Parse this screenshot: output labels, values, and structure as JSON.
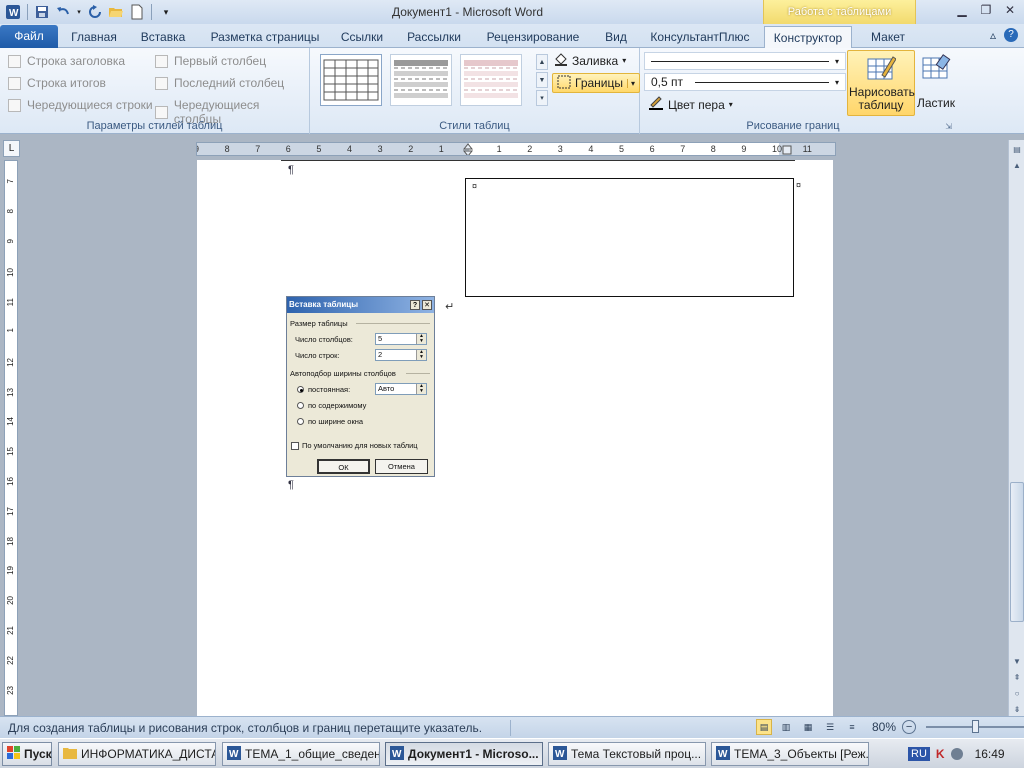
{
  "window": {
    "title": "Документ1  -  Microsoft Word",
    "context_tab_header": "Работа с таблицами"
  },
  "tabs": [
    "Файл",
    "Главная",
    "Вставка",
    "Разметка страницы",
    "Ссылки",
    "Рассылки",
    "Рецензирование",
    "Вид",
    "КонсультантПлюс",
    "Конструктор",
    "Макет"
  ],
  "ribbon": {
    "style_options": {
      "label": "Параметры стилей таблиц",
      "items": [
        "Строка заголовка",
        "Строка итогов",
        "Чередующиеся строки",
        "Первый столбец",
        "Последний столбец",
        "Чередующиеся столбцы"
      ]
    },
    "table_styles": {
      "label": "Стили таблиц",
      "fill_label": "Заливка",
      "borders_label": "Границы"
    },
    "draw_borders": {
      "label": "Рисование границ",
      "line_weight": "0,5 пт",
      "pen_color_label": "Цвет пера",
      "draw_table_label": "Нарисовать таблицу",
      "eraser_label": "Ластик"
    }
  },
  "ruler": {
    "h_ticks": [
      "9",
      "8",
      "7",
      "6",
      "5",
      "4",
      "3",
      "2",
      "1",
      "1",
      "2",
      "3",
      "4",
      "5",
      "6",
      "7",
      "8",
      "9",
      "10",
      "11"
    ],
    "v_ticks": [
      "7",
      "8",
      "9",
      "10",
      "11",
      "1",
      "12",
      "13",
      "14",
      "15",
      "16",
      "17",
      "18",
      "19",
      "20",
      "21",
      "22",
      "23",
      "24"
    ]
  },
  "document": {
    "pilcrow": "¶",
    "cell_mark": "¤"
  },
  "dialog": {
    "title": "Вставка таблицы",
    "help_btn": "?",
    "close_btn": "✕",
    "size_section": "Размер таблицы",
    "cols_label": "Число столбцов:",
    "cols_value": "5",
    "rows_label": "Число строк:",
    "rows_value": "2",
    "autofit_section": "Автоподбор ширины столбцов",
    "fixed_label": "постоянная:",
    "fixed_value": "Авто",
    "content_label": "по содержимому",
    "window_label": "по ширине окна",
    "default_label": "По умолчанию для новых таблиц",
    "ok_label": "ОК",
    "cancel_label": "Отмена"
  },
  "statusbar": {
    "hint": "Для создания таблицы и рисования строк, столбцов и границ перетащите указатель.",
    "zoom": "80%"
  },
  "taskbar": {
    "start_label": "Пуск",
    "tasks": [
      "ИНФОРМАТИКА_ДИСТА...",
      "ТЕМА_1_общие_сведен...",
      "Документ1 - Microso...",
      "Тема   Текстовый проц...",
      "ТЕМА_3_Объекты [Реж..."
    ],
    "lang": "RU",
    "time": "16:49"
  },
  "colors": {
    "file_tab": "#2a6ab8",
    "context_header": "#f5de7d",
    "highlight": "#ffd86a",
    "dialog_title": "#2e63ae"
  }
}
